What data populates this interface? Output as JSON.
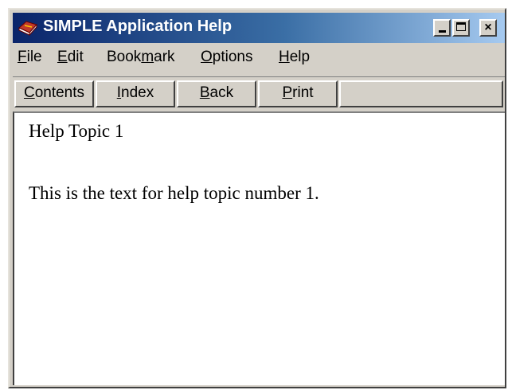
{
  "window": {
    "title": "SIMPLE Application Help",
    "controls": {
      "minimize": "minimize",
      "maximize": "maximize",
      "close": "×"
    }
  },
  "menubar": {
    "items": [
      {
        "label": "File",
        "underline": "F"
      },
      {
        "label": "Edit",
        "underline": "E"
      },
      {
        "label": "Bookmark",
        "underline": "m"
      },
      {
        "label": "Options",
        "underline": "O"
      },
      {
        "label": "Help",
        "underline": "H"
      }
    ]
  },
  "toolbar": {
    "buttons": [
      {
        "label": "Contents",
        "underline": "C"
      },
      {
        "label": "Index",
        "underline": "I"
      },
      {
        "label": "Back",
        "underline": "B"
      },
      {
        "label": "Print",
        "underline": "P"
      }
    ]
  },
  "content": {
    "topic_title": "Help Topic 1",
    "topic_text": "This is the text for help topic number 1."
  },
  "colors": {
    "titlebar_start": "#0a246a",
    "titlebar_end": "#a6caf0",
    "window_face": "#d4d0c8",
    "content_background": "#ffffff"
  }
}
